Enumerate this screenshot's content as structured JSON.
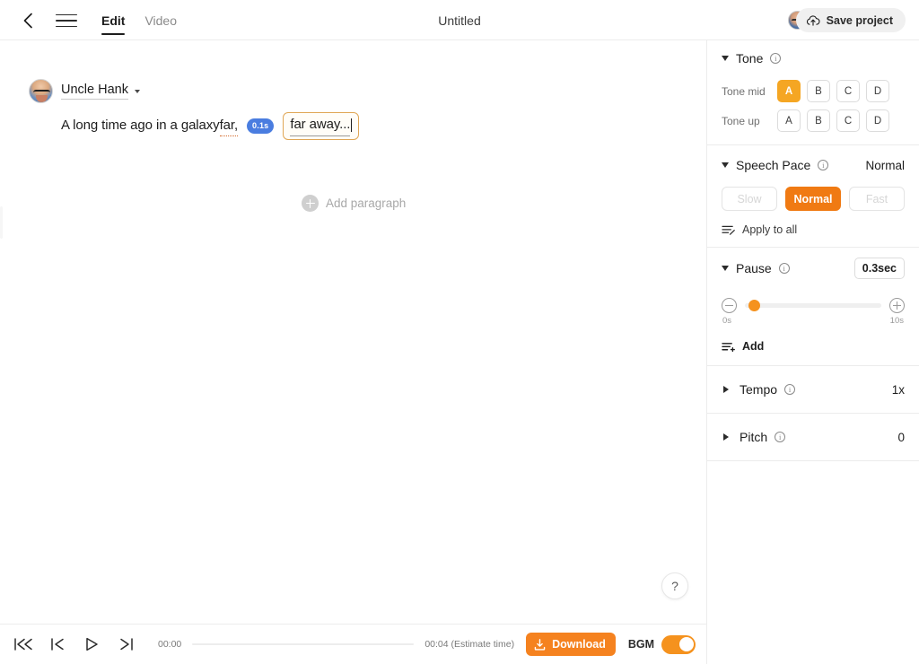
{
  "header": {
    "back_icon": "chevron-left-icon",
    "menu_icon": "hamburger-menu-icon",
    "tabs": [
      {
        "label": "Edit",
        "active": true
      },
      {
        "label": "Video",
        "active": false
      }
    ],
    "document_title": "Untitled",
    "avatar_icon": "user-avatar",
    "save_label": "Save project",
    "save_icon": "cloud-upload-icon"
  },
  "editor": {
    "speaker": {
      "name": "Uncle Hank",
      "avatar_icon": "speaker-avatar",
      "caret_icon": "chevron-down-icon"
    },
    "paragraph": {
      "text_before": "A long time ago in a galaxy ",
      "word_underlined": "far,",
      "pause_badge": "0.1s",
      "selected_text": "far away..."
    },
    "add_paragraph_label": "Add paragraph",
    "add_paragraph_icon": "plus-circle-icon",
    "help_label": "?",
    "help_icon": "help-icon"
  },
  "panel": {
    "tone": {
      "title": "Tone",
      "info_icon": "info-icon",
      "expand_icon": "triangle-down-icon",
      "rows": [
        {
          "label": "Tone mid",
          "options": [
            "A",
            "B",
            "C",
            "D"
          ],
          "selected": "A"
        },
        {
          "label": "Tone up",
          "options": [
            "A",
            "B",
            "C",
            "D"
          ],
          "selected": ""
        }
      ]
    },
    "speech_pace": {
      "title": "Speech Pace",
      "info_icon": "info-icon",
      "expand_icon": "triangle-down-icon",
      "value": "Normal",
      "options": [
        {
          "label": "Slow",
          "state": "disabled"
        },
        {
          "label": "Normal",
          "state": "selected"
        },
        {
          "label": "Fast",
          "state": "disabled"
        }
      ],
      "apply_all_label": "Apply to all",
      "apply_all_icon": "apply-to-all-icon"
    },
    "pause": {
      "title": "Pause",
      "info_icon": "info-icon",
      "expand_icon": "triangle-down-icon",
      "value": "0.3sec",
      "minus_icon": "minus-circle-icon",
      "plus_icon": "plus-circle-icon",
      "slider": {
        "min_label": "0s",
        "max_label": "10s",
        "min": 0,
        "max": 10,
        "current": 0.3
      },
      "add_label": "Add",
      "add_icon": "add-pause-icon"
    },
    "tempo": {
      "title": "Tempo",
      "info_icon": "info-icon",
      "expand_icon": "triangle-right-icon",
      "value": "1x"
    },
    "pitch": {
      "title": "Pitch",
      "info_icon": "info-icon",
      "expand_icon": "triangle-right-icon",
      "value": "0"
    }
  },
  "bottom": {
    "transport": [
      {
        "name": "skip-to-start-button",
        "icon": "skip-to-start-icon"
      },
      {
        "name": "previous-button",
        "icon": "step-backward-icon"
      },
      {
        "name": "play-button",
        "icon": "play-icon"
      },
      {
        "name": "next-button",
        "icon": "step-forward-icon"
      }
    ],
    "current_time": "00:00",
    "total_time": "00:04 (Estimate time)",
    "download_label": "Download",
    "download_icon": "download-icon",
    "bgm_label": "BGM",
    "bgm_on": true
  },
  "colors": {
    "accent_orange": "#f5921e",
    "pace_orange": "#f07a13",
    "tone_orange": "#f5a623",
    "pause_badge_blue": "#4a7de0",
    "selection_border": "#e0a756"
  }
}
